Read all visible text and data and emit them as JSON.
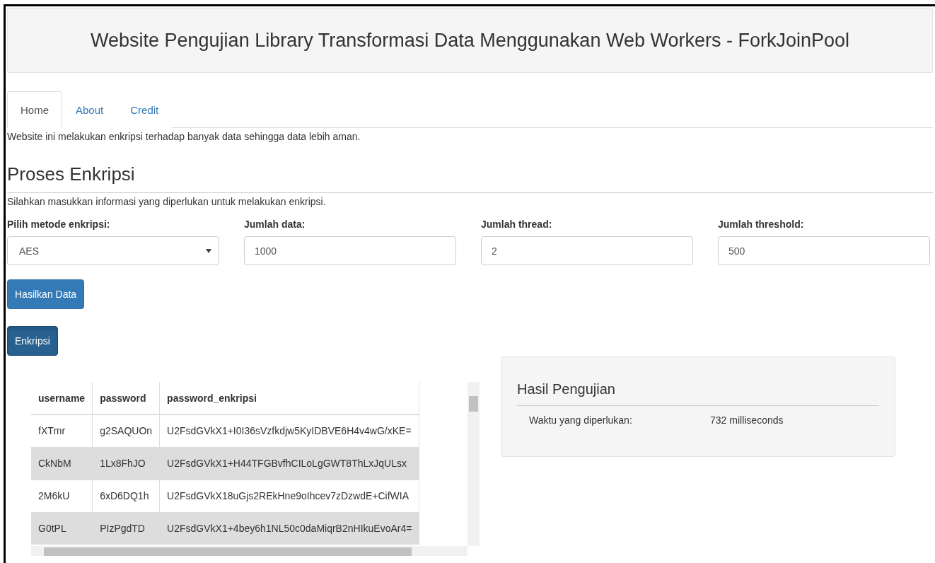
{
  "header": {
    "title": "Website Pengujian Library Transformasi Data Menggunakan Web Workers - ForkJoinPool"
  },
  "tabs": [
    {
      "label": "Home",
      "selected": true
    },
    {
      "label": "About",
      "selected": false
    },
    {
      "label": "Credit",
      "selected": false
    }
  ],
  "intro": "Website ini melakukan enkripsi terhadap banyak data sehingga data lebih aman.",
  "section": {
    "title": "Proses Enkripsi",
    "description": "Silahkan masukkan informasi yang diperlukan untuk melakukan enkripsi."
  },
  "fields": [
    {
      "kind": "select",
      "label": "Pilih metode enkripsi:",
      "value": "AES"
    },
    {
      "kind": "input",
      "label": "Jumlah data:",
      "value": "1000"
    },
    {
      "kind": "input",
      "label": "Jumlah thread:",
      "value": "2"
    },
    {
      "kind": "input",
      "label": "Jumlah threshold:",
      "value": "500"
    }
  ],
  "buttons": [
    {
      "label": "Hasilkan Data",
      "kind": "primary"
    },
    {
      "label": "Enkripsi",
      "kind": "active"
    }
  ],
  "table": {
    "columns": [
      "username",
      "password",
      "password_enkripsi"
    ],
    "rows": [
      [
        "fXTmr",
        "g2SAQUOn",
        "U2FsdGVkX1+I0I36sVzfkdjw5KyIDBVE6H4v4wG/xKE="
      ],
      [
        "CkNbM",
        "1Lx8FhJO",
        "U2FsdGVkX1+H44TFGBvfhCILoLgGWT8ThLxJqULsx"
      ],
      [
        "2M6kU",
        "6xD6DQ1h",
        "U2FsdGVkX18uGjs2REkHne9oIhcev7zDzwdE+CifWIA"
      ],
      [
        "G0tPL",
        "PIzPgdTD",
        "U2FsdGVkX1+4bey6h1NL50c0daMiqrB2nHIkuEvoAr4="
      ]
    ]
  },
  "results": {
    "title": "Hasil Pengujian",
    "rows": [
      {
        "label": "Waktu yang diperlukan:",
        "value": "732 milliseconds"
      }
    ]
  }
}
